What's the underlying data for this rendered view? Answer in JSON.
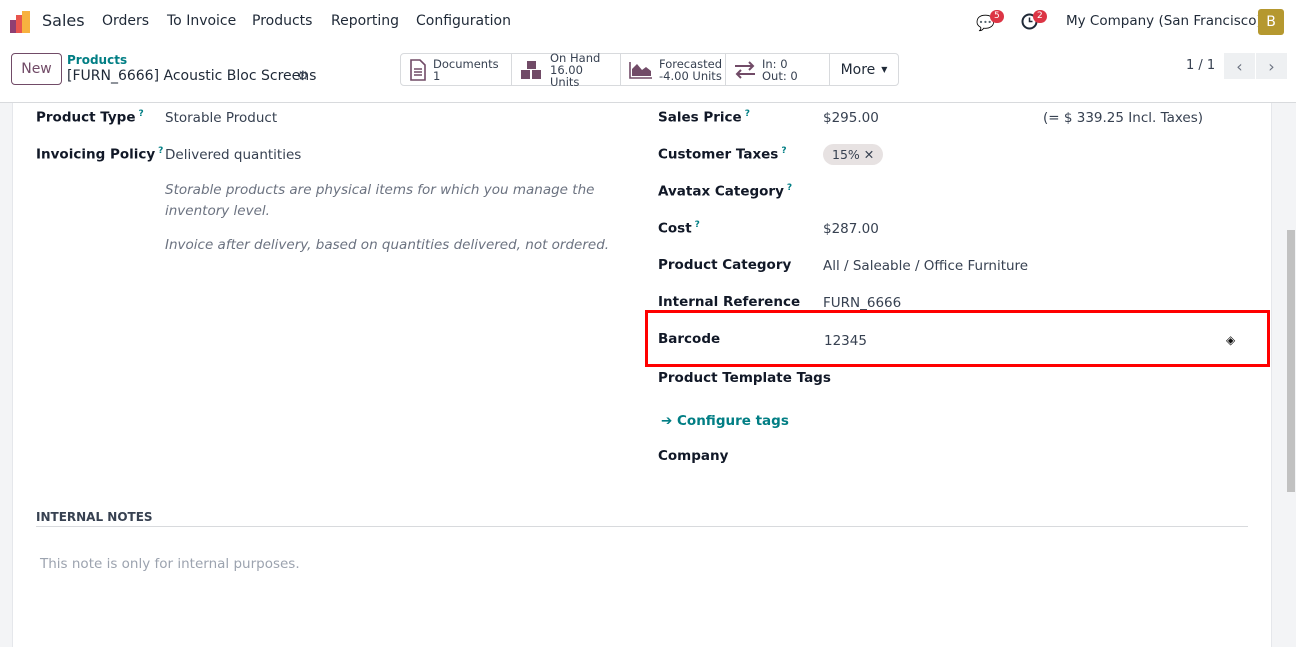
{
  "nav": {
    "app": "Sales",
    "menu": [
      "Orders",
      "To Invoice",
      "Products",
      "Reporting",
      "Configuration"
    ],
    "messages_count": "5",
    "activities_count": "2",
    "company": "My Company (San Francisco)",
    "avatar": "B"
  },
  "control": {
    "new_label": "New",
    "breadcrumb_parent": "Products",
    "record_title": "[FURN_6666] Acoustic Bloc Screens",
    "stats": {
      "documents_label": "Documents",
      "documents_value": "1",
      "onhand_label": "On Hand",
      "onhand_value": "16.00 Units",
      "forecast_label": "Forecasted",
      "forecast_value": "-4.00 Units",
      "in": "In: 0",
      "out": "Out: 0",
      "more": "More"
    },
    "pager": "1 / 1"
  },
  "left": {
    "product_type_label": "Product Type",
    "product_type": "Storable Product",
    "invoicing_policy_label": "Invoicing Policy",
    "invoicing_policy": "Delivered quantities",
    "help1": "Storable products are physical items for which you manage the inventory level.",
    "help2": "Invoice after delivery, based on quantities delivered, not ordered."
  },
  "right": {
    "sales_price_label": "Sales Price",
    "sales_price": "$295.00",
    "incl_taxes": "(= $ 339.25 Incl. Taxes)",
    "customer_taxes_label": "Customer Taxes",
    "tax_tag": "15%",
    "avatax_label": "Avatax Category",
    "cost_label": "Cost",
    "cost": "$287.00",
    "category_label": "Product Category",
    "category": "All / Saleable / Office Furniture",
    "internal_ref_label": "Internal Reference",
    "internal_ref": "FURN_6666",
    "barcode_label": "Barcode",
    "barcode": "12345",
    "tags_label": "Product Template Tags",
    "configure_tags": "Configure tags",
    "company_label": "Company"
  },
  "notes": {
    "heading": "INTERNAL NOTES",
    "placeholder": "This note is only for internal purposes."
  },
  "colors": {
    "brand": "#714b67",
    "link": "#017e84",
    "highlight": "#ff0000",
    "badge": "#dc3545",
    "avatar": "#b5982f"
  }
}
